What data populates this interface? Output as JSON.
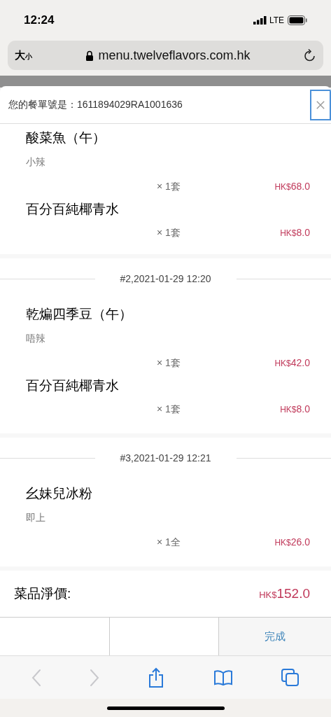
{
  "status_bar": {
    "time": "12:24",
    "network": "LTE"
  },
  "browser": {
    "text_size_button": {
      "large": "大",
      "small": "小"
    },
    "url": "menu.twelveflavors.com.hk"
  },
  "dialog": {
    "order_number_label": "您的餐單號是：1611894029RA1001636",
    "orders": [
      {
        "items": [
          {
            "name": "酸菜魚（午）",
            "note": "小辣",
            "qty": "× 1套",
            "currency": "HK$",
            "amount": "68.0"
          },
          {
            "name": "百分百純椰青水",
            "qty": "× 1套",
            "currency": "HK$",
            "amount": "8.0"
          }
        ]
      },
      {
        "header": "#2,2021-01-29 12:20",
        "items": [
          {
            "name": "乾煸四季豆（午）",
            "note": "唔辣",
            "qty": "× 1套",
            "currency": "HK$",
            "amount": "42.0"
          },
          {
            "name": "百分百純椰青水",
            "qty": "× 1套",
            "currency": "HK$",
            "amount": "8.0"
          }
        ]
      },
      {
        "header": "#3,2021-01-29 12:21",
        "items": [
          {
            "name": "幺妹兒冰粉",
            "note": "即上",
            "qty": "× 1全",
            "currency": "HK$",
            "amount": "26.0"
          }
        ]
      }
    ],
    "total": {
      "label": "菜品淨價:",
      "currency": "HK$",
      "amount": "152.0"
    },
    "done_button": "完成"
  },
  "toolbar": {
    "back_disabled": true,
    "forward_disabled": true
  }
}
